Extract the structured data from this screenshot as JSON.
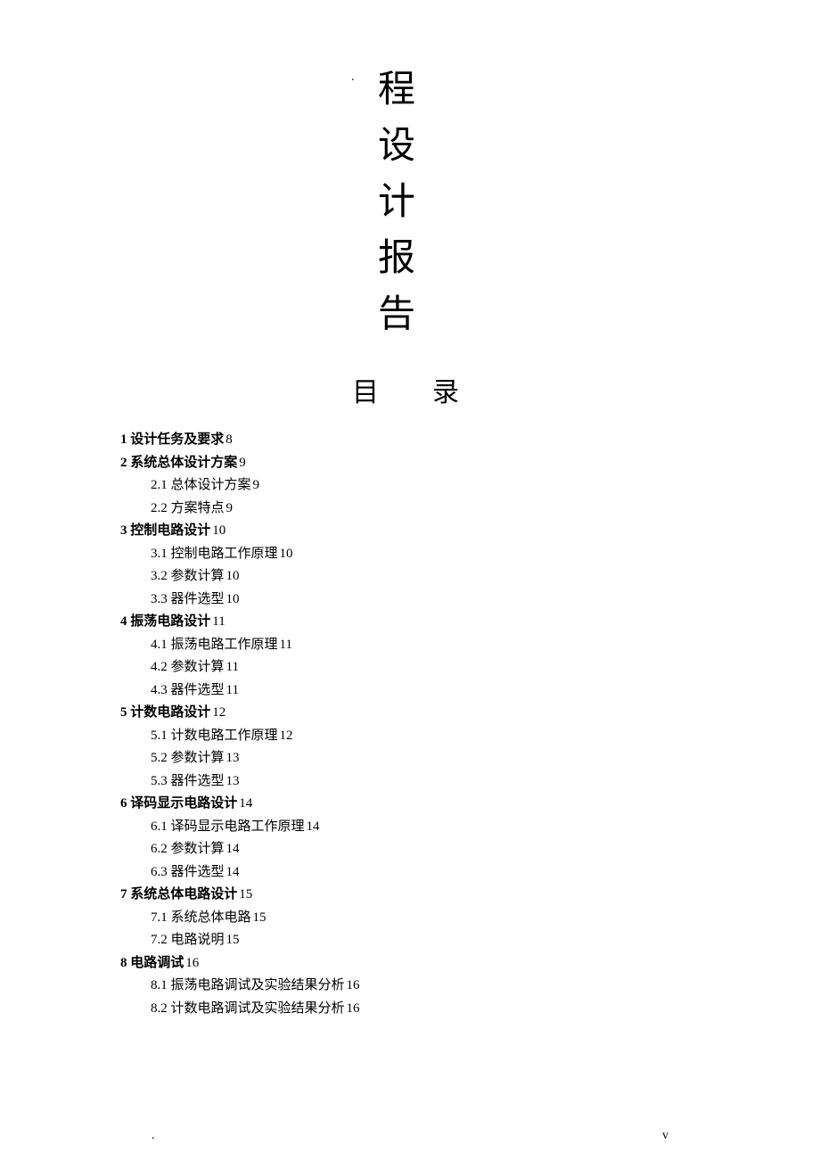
{
  "title": {
    "chars": [
      "程",
      "设",
      "计",
      "报",
      "告"
    ]
  },
  "toc_heading": {
    "part1": "目",
    "part2": "录"
  },
  "toc": [
    {
      "level": 1,
      "num": "1",
      "label": "设计任务及要求",
      "page": "8"
    },
    {
      "level": 1,
      "num": "2",
      "label": "系统总体设计方案",
      "page": "9"
    },
    {
      "level": 2,
      "num": "2.1",
      "label": "总体设计方案",
      "page": "9"
    },
    {
      "level": 2,
      "num": "2.2",
      "label": "方案特点",
      "page": "9"
    },
    {
      "level": 1,
      "num": "3",
      "label": "控制电路设计",
      "page": "10"
    },
    {
      "level": 2,
      "num": "3.1",
      "label": "控制电路工作原理",
      "page": "10"
    },
    {
      "level": 2,
      "num": "3.2",
      "label": "参数计算",
      "page": "10"
    },
    {
      "level": 2,
      "num": "3.3",
      "label": "器件选型",
      "page": "10"
    },
    {
      "level": 1,
      "num": "4 ",
      "label": "振荡电路设计",
      "page": "11"
    },
    {
      "level": 2,
      "num": "4.1",
      "label": "振荡电路工作原理",
      "page": "11"
    },
    {
      "level": 2,
      "num": "4.2",
      "label": "参数计算",
      "page": "11"
    },
    {
      "level": 2,
      "num": "4.3",
      "label": "器件选型",
      "page": "11"
    },
    {
      "level": 1,
      "num": "5 ",
      "label": "计数电路设计",
      "page": "12"
    },
    {
      "level": 2,
      "num": "5.1",
      "label": "计数电路工作原理",
      "page": "12"
    },
    {
      "level": 2,
      "num": "5.2",
      "label": "参数计算",
      "page": "13"
    },
    {
      "level": 2,
      "num": "5.3",
      "label": "器件选型",
      "page": "13"
    },
    {
      "level": 1,
      "num": "6 ",
      "label": "译码显示电路设计",
      "page": "14"
    },
    {
      "level": 2,
      "num": "6.1",
      "label": "译码显示电路工作原理",
      "page": "14"
    },
    {
      "level": 2,
      "num": "6.2",
      "label": "参数计算",
      "page": "14"
    },
    {
      "level": 2,
      "num": "6.3",
      "label": "器件选型",
      "page": "14"
    },
    {
      "level": 1,
      "num": "7",
      "label": "系统总体电路设计",
      "page": "15"
    },
    {
      "level": 2,
      "num": "7.1 ",
      "label": "系统总体电路",
      "page": "15"
    },
    {
      "level": 2,
      "num": "7.2 ",
      "label": " 电路说明",
      "page": "15"
    },
    {
      "level": 1,
      "num": "8",
      "label": "电路调试",
      "page": "16"
    },
    {
      "level": 2,
      "num": "8.1",
      "label": "振荡电路调试及实验结果分析",
      "page": "16"
    },
    {
      "level": 2,
      "num": "8.2 ",
      "label": " 计数电路调试及实验结果分析",
      "page": "16"
    }
  ],
  "footer": "v",
  "top_dot": ".",
  "bottom_dot": "."
}
